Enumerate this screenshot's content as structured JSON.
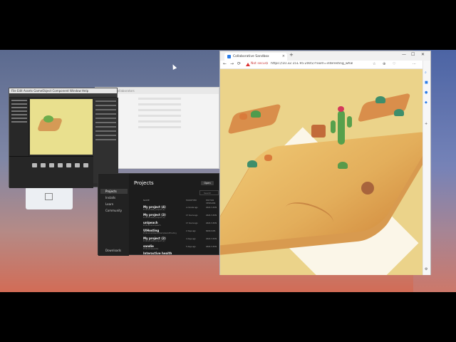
{
  "browser": {
    "tab_title": "Collaborative Sandbox",
    "tab_close": "×",
    "new_tab": "+",
    "not_secure": "Not secure",
    "url": "https://10.32.151.95:2005/?room=interesting_whale_545",
    "window_controls": [
      "—",
      "☐",
      "✕"
    ],
    "nav": [
      "←",
      "→",
      "⟳"
    ],
    "toolbar_icons": [
      "☆",
      "⊕",
      "♡",
      "⋯"
    ],
    "sidebar_icons": [
      "search-icon",
      "briefcase-icon",
      "outlook-icon",
      "office-icon",
      "add-icon",
      "settings-icon"
    ]
  },
  "unity_editor": {
    "menu": "File  Edit  Assets  GameObject  Component  Window  Help"
  },
  "pale_window": {
    "title": "Collaborators"
  },
  "unity_hub": {
    "title": "Projects",
    "open_button": "Open",
    "search_placeholder": "Search",
    "nav": [
      "Projects",
      "Installs",
      "Learn",
      "Community",
      "Downloads"
    ],
    "columns": [
      "NAME",
      "MODIFIED",
      "EDITOR VERSION"
    ],
    "projects": [
      {
        "name": "My project (4)",
        "path": "D:\\Source\\My project (4)",
        "modified": "a minute ago",
        "version": "2022.3.30f1"
      },
      {
        "name": "My project (3)",
        "path": "D:\\Source\\My project (3)",
        "modified": "17 hours ago",
        "version": "2022.3.30f1"
      },
      {
        "name": "unipeach",
        "path": "D:\\Source\\unipeach",
        "modified": "17 hours ago",
        "version": "2022.3.30f1"
      },
      {
        "name": "UIHosting",
        "path": "D:\\Source\\Oberon\\Samples\\UIHosting",
        "modified": "2 days ago",
        "version": "6000.0.0f1"
      },
      {
        "name": "My project (2)",
        "path": "D:\\Source\\My project (2)",
        "modified": "4 days ago",
        "version": "2022.3.30f1"
      },
      {
        "name": "sandie",
        "path": "D:\\Source\\sandie",
        "modified": "5 days ago",
        "version": "2022.3.30f1"
      },
      {
        "name": "Interactive health",
        "path": "",
        "modified": "",
        "version": ""
      }
    ]
  }
}
